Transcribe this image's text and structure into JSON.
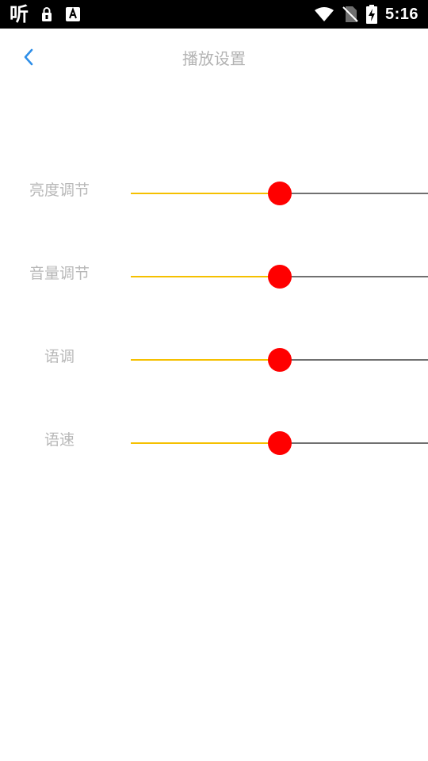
{
  "status_bar": {
    "app_glyph": "听",
    "time": "5:16",
    "icons": [
      "lock-notification-icon",
      "a-notification-icon",
      "wifi-icon",
      "no-sim-icon",
      "battery-charging-icon"
    ]
  },
  "header": {
    "title": "播放设置",
    "back_icon": "chevron-left-icon"
  },
  "colors": {
    "accent_fill": "#f5c000",
    "thumb": "#ff0000",
    "track": "#707070",
    "label": "#b8b8b8",
    "back_icon": "#2f8fe8"
  },
  "settings": [
    {
      "label": "亮度调节",
      "value": 0.5
    },
    {
      "label": "音量调节",
      "value": 0.5
    },
    {
      "label": "语调",
      "value": 0.5
    },
    {
      "label": "语速",
      "value": 0.5
    }
  ]
}
